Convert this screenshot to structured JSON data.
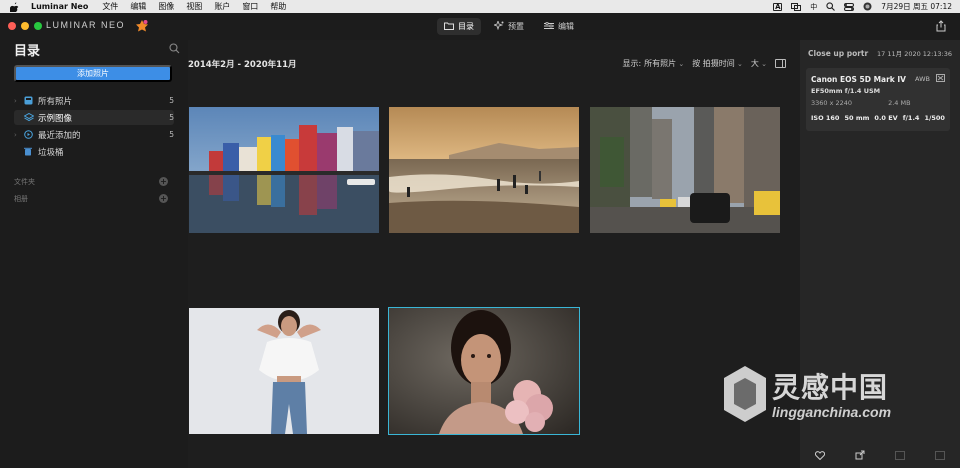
{
  "menubar": {
    "app_name": "Luminar Neo",
    "items": [
      "文件",
      "编辑",
      "图像",
      "视图",
      "账户",
      "窗口",
      "帮助"
    ],
    "status_badge": "A",
    "ime": "中",
    "clock": "7月29日 周五  07:12"
  },
  "toolbar": {
    "logo": "LUMINAR NEO",
    "tabs": [
      {
        "label": "目录",
        "icon": "folder-icon",
        "active": true
      },
      {
        "label": "预置",
        "icon": "sparkle-icon",
        "active": false
      },
      {
        "label": "编辑",
        "icon": "sliders-icon",
        "active": false
      }
    ]
  },
  "sidebar": {
    "title": "目录",
    "add_button": "添加照片",
    "items": [
      {
        "label": "所有照片",
        "count": "5",
        "icon": "photos-icon"
      },
      {
        "label": "示例图像",
        "count": "5",
        "icon": "layers-icon",
        "selected": true
      },
      {
        "label": "最近添加的",
        "count": "5",
        "icon": "recent-icon"
      },
      {
        "label": "垃圾桶",
        "count": "",
        "icon": "trash-icon"
      }
    ],
    "sections": [
      {
        "label": "文件夹"
      },
      {
        "label": "相册"
      }
    ]
  },
  "main": {
    "date_range": "2014年2月 - 2020年11月",
    "filter_label": "显示:",
    "filter_value": "所有照片",
    "sort_value": "按 拍摄时间",
    "size_value": "大",
    "photos": [
      {
        "name": "colorful-houses-harbor"
      },
      {
        "name": "beach-sunset"
      },
      {
        "name": "city-street-taxis"
      },
      {
        "name": "woman-white-shirt"
      },
      {
        "name": "woman-portrait-pink",
        "selected": true
      }
    ]
  },
  "info_panel": {
    "title": "Close up portr",
    "datetime": "17 11月 2020 12:13:36",
    "camera": "Canon EOS 5D Mark IV",
    "wb": "AWB",
    "lens": "EF50mm f/1.4 USM",
    "resolution": "3360 x 2240",
    "filesize": "2.4 MB",
    "iso": "ISO 160",
    "focal": "50 mm",
    "ev": "0.0 EV",
    "aperture": "f/1.4",
    "shutter": "1/500"
  },
  "watermark": {
    "title": "灵感中国",
    "url": "lingganchina.com"
  }
}
